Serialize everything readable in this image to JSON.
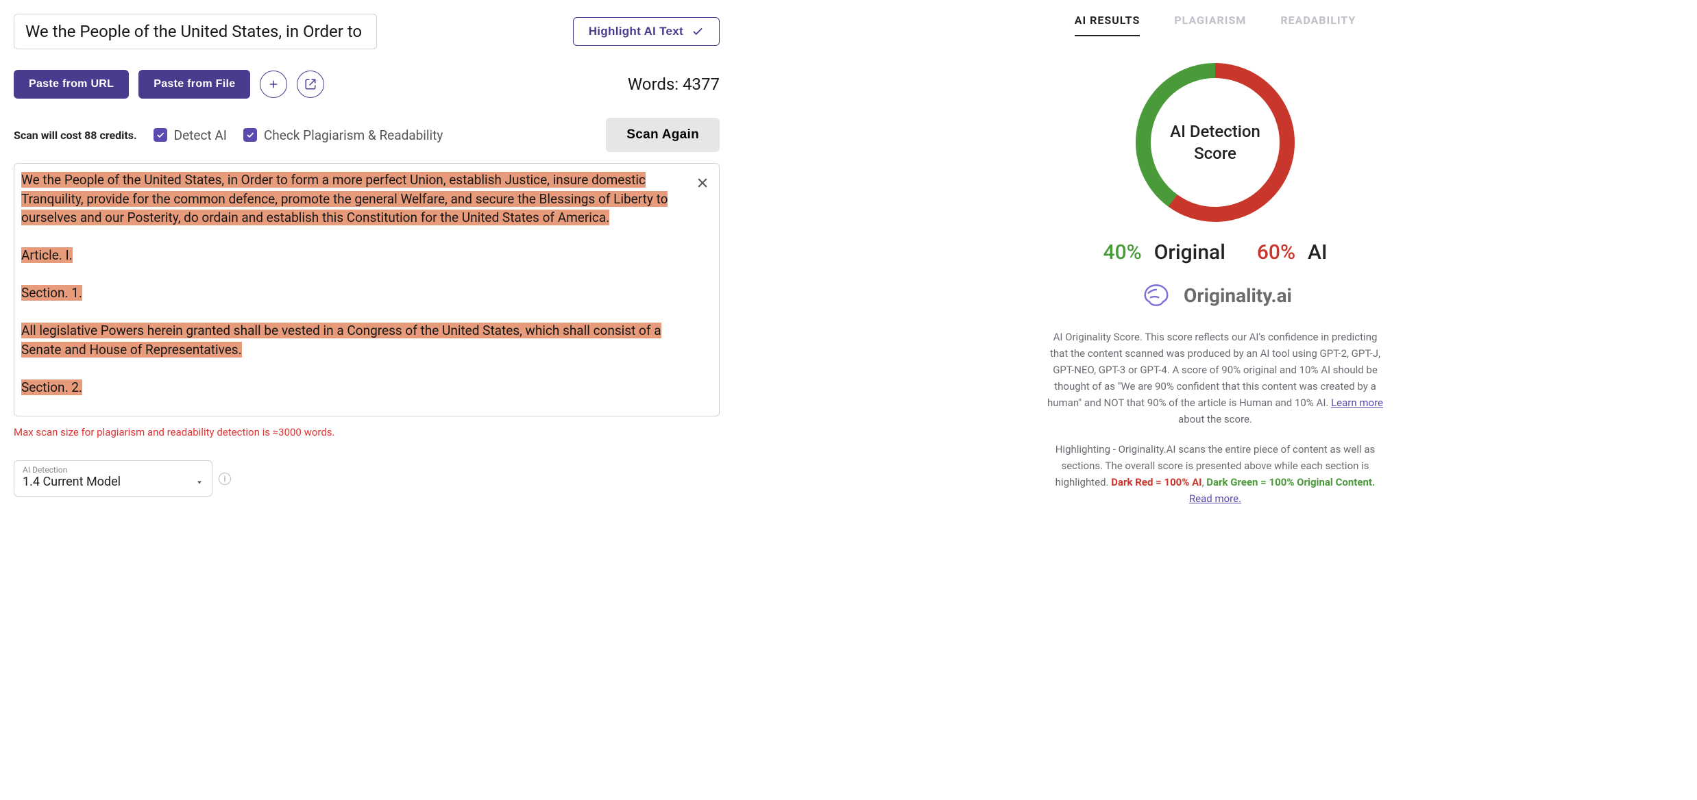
{
  "title_input": "We the People of the United States, in Order to",
  "highlight_btn": "Highlight AI Text",
  "actions": {
    "paste_url": "Paste from URL",
    "paste_file": "Paste from File"
  },
  "words_label": "Words: 4377",
  "credit_cost": "Scan will cost 88 credits.",
  "options": {
    "detect_ai": "Detect AI",
    "check_plag": "Check Plagiarism & Readability"
  },
  "scan_again": "Scan Again",
  "textarea": {
    "p1": "We the People of the United States, in Order to form a more perfect Union, establish Justice, insure domestic Tranquility, provide for the common defence, promote the general Welfare, and secure the Blessings of Liberty to ourselves and our Posterity, do ordain and establish this Constitution for the United States of America.",
    "p2": "Article. I.",
    "p3": "Section. 1.",
    "p4": "All legislative Powers herein granted shall be vested in a Congress of the United States, which shall consist of a Senate and House of Representatives.",
    "p5": "Section. 2."
  },
  "max_scan_warn": "Max scan size for plagiarism and readability detection is ≈3000 words.",
  "model_select": {
    "label": "AI Detection",
    "value": "1.4 Current Model"
  },
  "tabs": {
    "ai_results": "AI RESULTS",
    "plagiarism": "PLAGIARISM",
    "readability": "READABILITY"
  },
  "donut": {
    "center_line1": "AI Detection",
    "center_line2": "Score"
  },
  "score": {
    "original_pct": "40%",
    "original_lbl": "Original",
    "ai_pct": "60%",
    "ai_lbl": "AI"
  },
  "brand": "Originality.ai",
  "desc1_a": "AI Originality Score. This score reflects our AI's confidence in predicting that the content scanned was produced by an AI tool using GPT-2, GPT-J, GPT-NEO, GPT-3 or GPT-4. A score of 90% original and 10% AI should be thought of as \"We are 90% confident that this content was created by a human\" and NOT that 90% of the article is Human and 10% AI. ",
  "desc1_link": "Learn more",
  "desc1_b": " about the score.",
  "desc2_a": "Highlighting - Originality.AI scans the entire piece of content as well as sections. The overall score is presented above while each section is highlighted. ",
  "desc2_red": "Dark Red = 100% AI",
  "desc2_sep": ", ",
  "desc2_green": "Dark Green = 100% Original Content.",
  "desc2_link": "Read more.",
  "chart_data": {
    "type": "pie",
    "title": "AI Detection Score",
    "series": [
      {
        "name": "Original",
        "value": 40,
        "color": "#4a9a3a"
      },
      {
        "name": "AI",
        "value": 60,
        "color": "#c9362c"
      }
    ]
  }
}
